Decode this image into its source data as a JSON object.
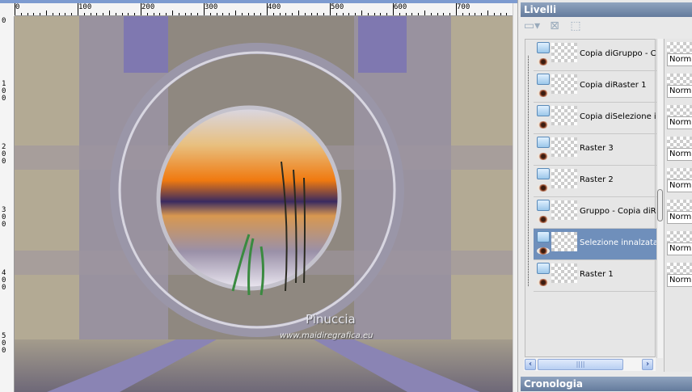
{
  "ruler": {
    "h_labels": [
      "0",
      "100",
      "200",
      "300",
      "400",
      "500",
      "600",
      "700"
    ],
    "v_labels": [
      "0",
      "100",
      "200",
      "300",
      "400",
      "500"
    ]
  },
  "canvas": {
    "watermark_name": "Pinuccia",
    "watermark_url": "www.maidiregrafica.eu"
  },
  "layers_panel": {
    "title": "Livelli",
    "toolbar": [
      {
        "icon": "new-layer-icon"
      },
      {
        "icon": "delete-layer-icon"
      },
      {
        "icon": "edit-selection-icon"
      }
    ],
    "layers": [
      {
        "name": "Copia diGruppo - Copia",
        "blend": "Normale",
        "selected": false
      },
      {
        "name": "Copia diRaster 1",
        "blend": "Normale",
        "selected": false
      },
      {
        "name": "Copia diSelezione innalzata",
        "blend": "Normale",
        "selected": false
      },
      {
        "name": "Raster 3",
        "blend": "Normale",
        "selected": false
      },
      {
        "name": "Raster 2",
        "blend": "Normale",
        "selected": false
      },
      {
        "name": "Gruppo - Copia diRaster",
        "blend": "Normale",
        "selected": false
      },
      {
        "name": "Selezione innalzata",
        "blend": "Normale",
        "selected": true
      },
      {
        "name": "Raster 1",
        "blend": "Normale",
        "selected": false
      }
    ],
    "blend_visible": "Norm"
  },
  "history_panel": {
    "title": "Cronologia"
  },
  "colors": {
    "selected_row": "#6f8fbb",
    "panel_title": "#647b9c"
  }
}
